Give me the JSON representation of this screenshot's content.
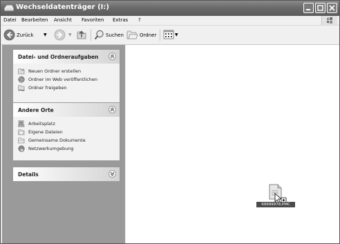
{
  "window": {
    "title": "Wechseldatenträger (I:)"
  },
  "menu": [
    "Datei",
    "Bearbeiten",
    "Ansicht",
    "Favoriten",
    "Extras",
    "?"
  ],
  "toolbar": {
    "back": "Zurück",
    "search": "Suchen",
    "folders": "Ordner"
  },
  "panels": {
    "tasks": {
      "title": "Datei- und Ordneraufgaben",
      "items": [
        "Neuen Ordner erstellen",
        "Ordner im Web veröffentlichen",
        "Ordner freigeben"
      ]
    },
    "places": {
      "title": "Andere Orte",
      "items": [
        "Arbeitsplatz",
        "Eigene Dateien",
        "Gemeinsame Dokumente",
        "Netzwerkumgebung"
      ]
    },
    "details": {
      "title": "Details"
    }
  },
  "drag_item": {
    "label": "99999978.PMC"
  },
  "icons": {
    "tasks": [
      "new-folder-icon",
      "publish-web-icon",
      "share-folder-icon"
    ],
    "places": [
      "my-computer-icon",
      "my-documents-icon",
      "shared-documents-icon",
      "network-icon"
    ]
  }
}
